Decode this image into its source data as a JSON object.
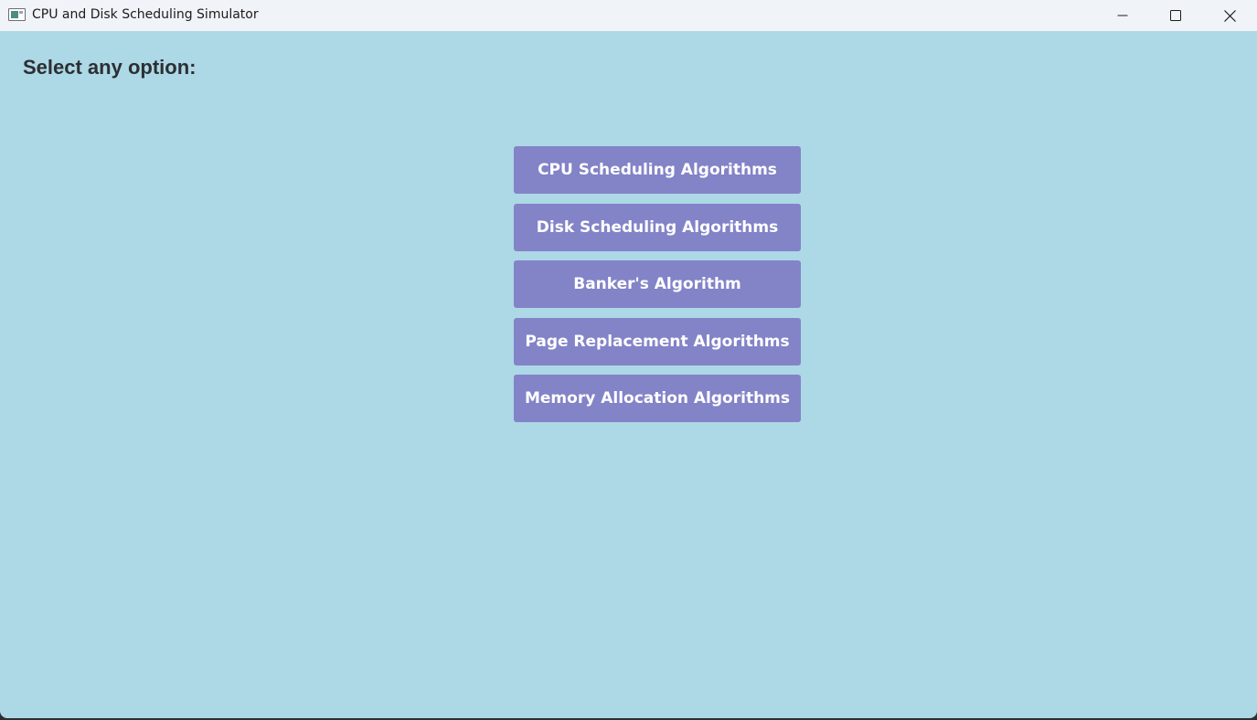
{
  "window": {
    "title": "CPU and Disk Scheduling Simulator",
    "icons": {
      "app": "app-window-icon",
      "minimize": "minimize-icon",
      "maximize": "maximize-icon",
      "close": "close-icon"
    }
  },
  "main": {
    "heading": "Select any option:",
    "buttons": [
      {
        "label": "CPU Scheduling Algorithms"
      },
      {
        "label": "Disk Scheduling Algorithms"
      },
      {
        "label": "Banker's Algorithm"
      },
      {
        "label": "Page Replacement Algorithms"
      },
      {
        "label": "Memory Allocation Algorithms"
      }
    ]
  },
  "colors": {
    "background": "#add8e6",
    "button": "#8383c8",
    "button_text": "#ffffff",
    "heading_text": "#2b2f33",
    "titlebar": "#f0f3f8"
  }
}
